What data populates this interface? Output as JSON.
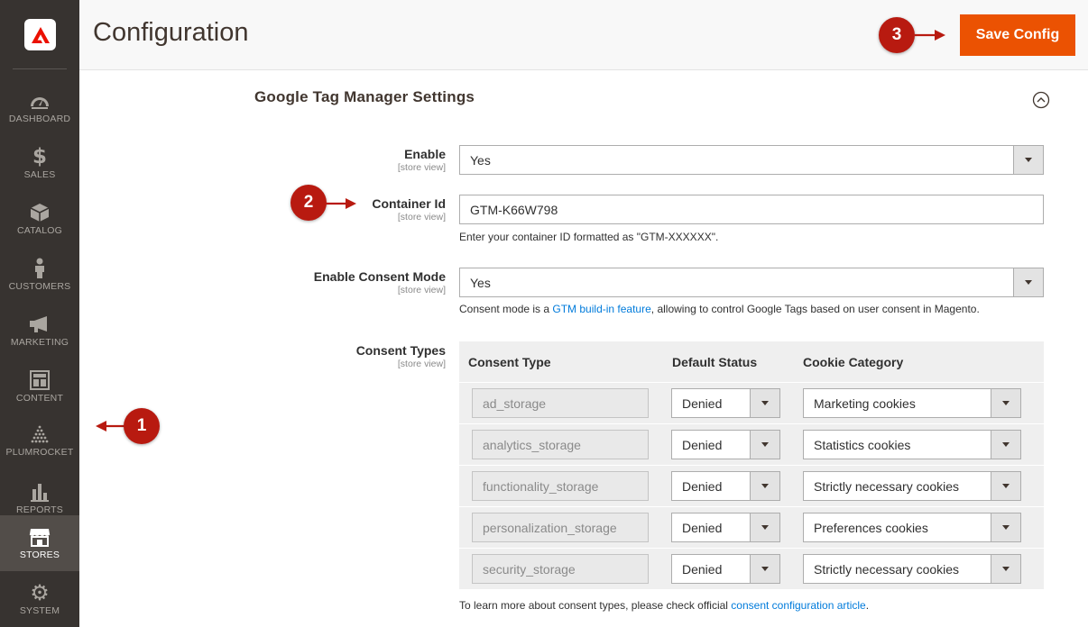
{
  "sidebar": {
    "logo_icon": "adobe-logo-icon",
    "items": [
      {
        "label": "DASHBOARD",
        "icon": "speedometer-icon"
      },
      {
        "label": "SALES",
        "icon": "dollar-icon"
      },
      {
        "label": "CATALOG",
        "icon": "box-icon"
      },
      {
        "label": "CUSTOMERS",
        "icon": "person-icon"
      },
      {
        "label": "MARKETING",
        "icon": "megaphone-icon"
      },
      {
        "label": "CONTENT",
        "icon": "layout-icon"
      },
      {
        "label": "PLUMROCKET",
        "icon": "plumrocket-icon"
      },
      {
        "label": "REPORTS",
        "icon": "bar-chart-icon"
      },
      {
        "label": "STORES",
        "icon": "store-icon"
      },
      {
        "label": "SYSTEM",
        "icon": "gear-icon"
      }
    ],
    "active": "STORES"
  },
  "header": {
    "title": "Configuration",
    "save_label": "Save Config"
  },
  "callouts": {
    "one": "1",
    "two": "2",
    "three": "3"
  },
  "section": {
    "title": "Google Tag Manager Settings"
  },
  "fields": {
    "enable": {
      "label": "Enable",
      "scope": "[store view]",
      "value": "Yes"
    },
    "container_id": {
      "label": "Container Id",
      "scope": "[store view]",
      "value": "GTM-K66W798",
      "note": "Enter your container ID formatted as \"GTM-XXXXXX\"."
    },
    "consent_mode": {
      "label": "Enable Consent Mode",
      "scope": "[store view]",
      "value": "Yes",
      "note_prefix": "Consent mode is a ",
      "note_link": "GTM build-in feature",
      "note_suffix": ", allowing to control Google Tags based on user consent in Magento."
    },
    "consent_types": {
      "label": "Consent Types",
      "scope": "[store view]"
    }
  },
  "consent_table": {
    "headers": {
      "type": "Consent Type",
      "status": "Default Status",
      "category": "Cookie Category"
    },
    "rows": [
      {
        "type": "ad_storage",
        "status": "Denied",
        "category": "Marketing cookies"
      },
      {
        "type": "analytics_storage",
        "status": "Denied",
        "category": "Statistics cookies"
      },
      {
        "type": "functionality_storage",
        "status": "Denied",
        "category": "Strictly necessary cookies"
      },
      {
        "type": "personalization_storage",
        "status": "Denied",
        "category": "Preferences cookies"
      },
      {
        "type": "security_storage",
        "status": "Denied",
        "category": "Strictly necessary cookies"
      }
    ],
    "footer_prefix": "To learn more about consent types, please check official ",
    "footer_link": "consent configuration article",
    "footer_suffix": "."
  },
  "colors": {
    "sidebar_bg": "#373330",
    "accent": "#eb5202",
    "callout": "#b81a10",
    "link": "#007bdb"
  }
}
